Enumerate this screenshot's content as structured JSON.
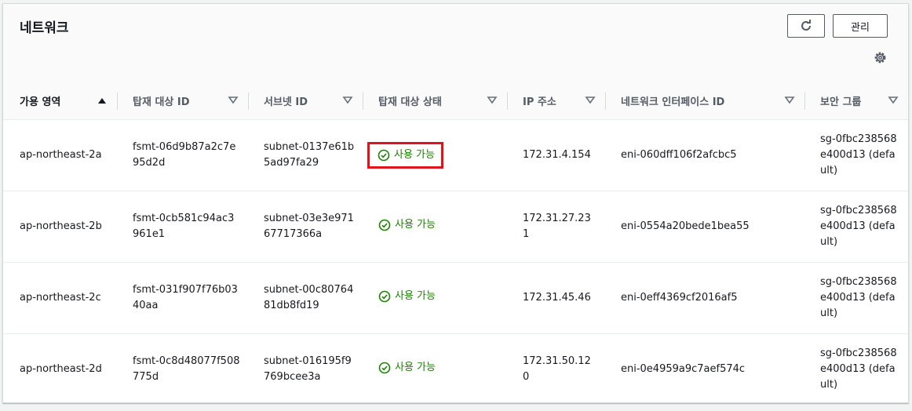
{
  "header": {
    "title": "네트워크",
    "refresh_icon": "refresh-icon",
    "manage_label": "관리",
    "settings_icon": "gear-icon"
  },
  "columns": [
    {
      "label": "가용 영역",
      "sort": "ascending"
    },
    {
      "label": "탑재 대상 ID",
      "sort": "none"
    },
    {
      "label": "서브넷 ID",
      "sort": "none"
    },
    {
      "label": "탑재 대상 상태",
      "sort": "none"
    },
    {
      "label": "IP 주소",
      "sort": "none"
    },
    {
      "label": "네트워크 인터페이스 ID",
      "sort": "none"
    },
    {
      "label": "보안 그룹",
      "sort": "none"
    }
  ],
  "rows": [
    {
      "az": "ap-northeast-2a",
      "mount_target_id": "fsmt-06d9b87a2c7e95d2d",
      "subnet_id": "subnet-0137e61b5ad97fa29",
      "status": "사용 가능",
      "ip": "172.31.4.154",
      "eni": "eni-060dff106f2afcbc5",
      "security_group": "sg-0fbc238568e400d13 (default)",
      "highlighted": true
    },
    {
      "az": "ap-northeast-2b",
      "mount_target_id": "fsmt-0cb581c94ac3961e1",
      "subnet_id": "subnet-03e3e97167717366a",
      "status": "사용 가능",
      "ip": "172.31.27.231",
      "eni": "eni-0554a20bede1bea55",
      "security_group": "sg-0fbc238568e400d13 (default)",
      "highlighted": false
    },
    {
      "az": "ap-northeast-2c",
      "mount_target_id": "fsmt-031f907f76b0340aa",
      "subnet_id": "subnet-00c8076481db8fd19",
      "status": "사용 가능",
      "ip": "172.31.45.46",
      "eni": "eni-0eff4369cf2016af5",
      "security_group": "sg-0fbc238568e400d13 (default)",
      "highlighted": false
    },
    {
      "az": "ap-northeast-2d",
      "mount_target_id": "fsmt-0c8d48077f508775d",
      "subnet_id": "subnet-016195f9769bcee3a",
      "status": "사용 가능",
      "ip": "172.31.50.120",
      "eni": "eni-0e4959a9c7aef574c",
      "security_group": "sg-0fbc238568e400d13 (default)",
      "highlighted": false
    }
  ],
  "colors": {
    "status_ok": "#1d8102",
    "highlight": "#e0121b"
  }
}
